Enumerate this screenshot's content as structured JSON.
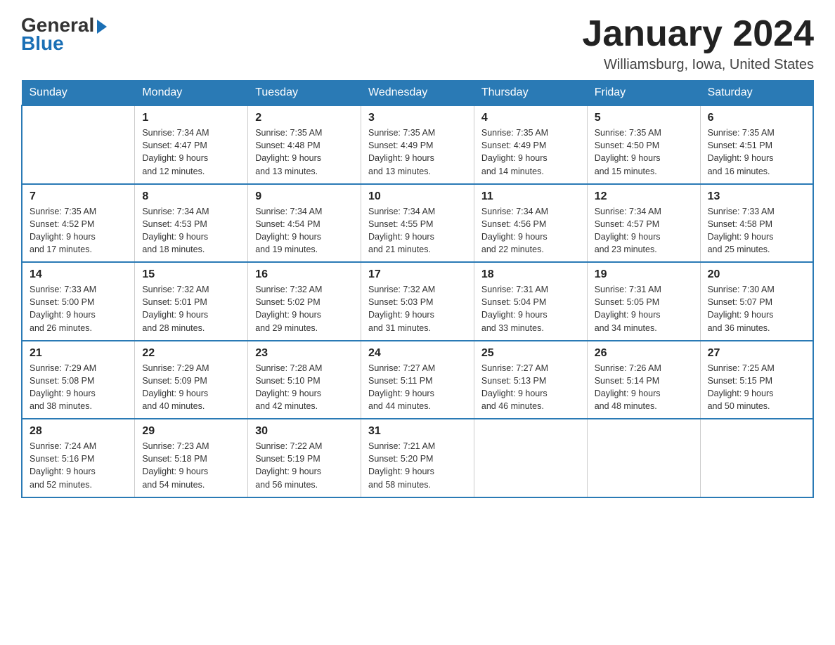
{
  "logo": {
    "general": "General",
    "blue": "Blue",
    "line2": "Blue"
  },
  "title": "January 2024",
  "subtitle": "Williamsburg, Iowa, United States",
  "days_of_week": [
    "Sunday",
    "Monday",
    "Tuesday",
    "Wednesday",
    "Thursday",
    "Friday",
    "Saturday"
  ],
  "weeks": [
    [
      null,
      {
        "day": 1,
        "sunrise": "7:34 AM",
        "sunset": "4:47 PM",
        "daylight": "9 hours and 12 minutes."
      },
      {
        "day": 2,
        "sunrise": "7:35 AM",
        "sunset": "4:48 PM",
        "daylight": "9 hours and 13 minutes."
      },
      {
        "day": 3,
        "sunrise": "7:35 AM",
        "sunset": "4:49 PM",
        "daylight": "9 hours and 13 minutes."
      },
      {
        "day": 4,
        "sunrise": "7:35 AM",
        "sunset": "4:49 PM",
        "daylight": "9 hours and 14 minutes."
      },
      {
        "day": 5,
        "sunrise": "7:35 AM",
        "sunset": "4:50 PM",
        "daylight": "9 hours and 15 minutes."
      },
      {
        "day": 6,
        "sunrise": "7:35 AM",
        "sunset": "4:51 PM",
        "daylight": "9 hours and 16 minutes."
      }
    ],
    [
      {
        "day": 7,
        "sunrise": "7:35 AM",
        "sunset": "4:52 PM",
        "daylight": "9 hours and 17 minutes."
      },
      {
        "day": 8,
        "sunrise": "7:34 AM",
        "sunset": "4:53 PM",
        "daylight": "9 hours and 18 minutes."
      },
      {
        "day": 9,
        "sunrise": "7:34 AM",
        "sunset": "4:54 PM",
        "daylight": "9 hours and 19 minutes."
      },
      {
        "day": 10,
        "sunrise": "7:34 AM",
        "sunset": "4:55 PM",
        "daylight": "9 hours and 21 minutes."
      },
      {
        "day": 11,
        "sunrise": "7:34 AM",
        "sunset": "4:56 PM",
        "daylight": "9 hours and 22 minutes."
      },
      {
        "day": 12,
        "sunrise": "7:34 AM",
        "sunset": "4:57 PM",
        "daylight": "9 hours and 23 minutes."
      },
      {
        "day": 13,
        "sunrise": "7:33 AM",
        "sunset": "4:58 PM",
        "daylight": "9 hours and 25 minutes."
      }
    ],
    [
      {
        "day": 14,
        "sunrise": "7:33 AM",
        "sunset": "5:00 PM",
        "daylight": "9 hours and 26 minutes."
      },
      {
        "day": 15,
        "sunrise": "7:32 AM",
        "sunset": "5:01 PM",
        "daylight": "9 hours and 28 minutes."
      },
      {
        "day": 16,
        "sunrise": "7:32 AM",
        "sunset": "5:02 PM",
        "daylight": "9 hours and 29 minutes."
      },
      {
        "day": 17,
        "sunrise": "7:32 AM",
        "sunset": "5:03 PM",
        "daylight": "9 hours and 31 minutes."
      },
      {
        "day": 18,
        "sunrise": "7:31 AM",
        "sunset": "5:04 PM",
        "daylight": "9 hours and 33 minutes."
      },
      {
        "day": 19,
        "sunrise": "7:31 AM",
        "sunset": "5:05 PM",
        "daylight": "9 hours and 34 minutes."
      },
      {
        "day": 20,
        "sunrise": "7:30 AM",
        "sunset": "5:07 PM",
        "daylight": "9 hours and 36 minutes."
      }
    ],
    [
      {
        "day": 21,
        "sunrise": "7:29 AM",
        "sunset": "5:08 PM",
        "daylight": "9 hours and 38 minutes."
      },
      {
        "day": 22,
        "sunrise": "7:29 AM",
        "sunset": "5:09 PM",
        "daylight": "9 hours and 40 minutes."
      },
      {
        "day": 23,
        "sunrise": "7:28 AM",
        "sunset": "5:10 PM",
        "daylight": "9 hours and 42 minutes."
      },
      {
        "day": 24,
        "sunrise": "7:27 AM",
        "sunset": "5:11 PM",
        "daylight": "9 hours and 44 minutes."
      },
      {
        "day": 25,
        "sunrise": "7:27 AM",
        "sunset": "5:13 PM",
        "daylight": "9 hours and 46 minutes."
      },
      {
        "day": 26,
        "sunrise": "7:26 AM",
        "sunset": "5:14 PM",
        "daylight": "9 hours and 48 minutes."
      },
      {
        "day": 27,
        "sunrise": "7:25 AM",
        "sunset": "5:15 PM",
        "daylight": "9 hours and 50 minutes."
      }
    ],
    [
      {
        "day": 28,
        "sunrise": "7:24 AM",
        "sunset": "5:16 PM",
        "daylight": "9 hours and 52 minutes."
      },
      {
        "day": 29,
        "sunrise": "7:23 AM",
        "sunset": "5:18 PM",
        "daylight": "9 hours and 54 minutes."
      },
      {
        "day": 30,
        "sunrise": "7:22 AM",
        "sunset": "5:19 PM",
        "daylight": "9 hours and 56 minutes."
      },
      {
        "day": 31,
        "sunrise": "7:21 AM",
        "sunset": "5:20 PM",
        "daylight": "9 hours and 58 minutes."
      },
      null,
      null,
      null
    ]
  ],
  "labels": {
    "sunrise": "Sunrise:",
    "sunset": "Sunset:",
    "daylight": "Daylight:"
  }
}
